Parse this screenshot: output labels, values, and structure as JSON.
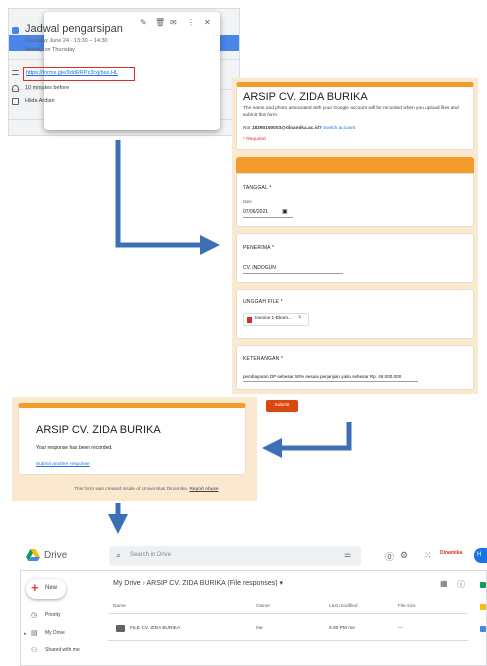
{
  "calendar": {
    "title": "Jadwal pengarsipan",
    "when": "Thursday June 24 · 13:30 – 14:30",
    "repeat": "Weekly on Thursday",
    "link": "https://forms.gle/9ddRRPz3rxj/bas.HL",
    "reminder": "10 minutes before",
    "owner": "Hilda Ardiari",
    "tools": [
      "✎",
      "🗑",
      "✉",
      "⋮",
      "✕"
    ]
  },
  "form": {
    "title": "ARSIP CV. ZIDA BURIKA",
    "description": "The name and photo associated with your Google account will be recorded when you upload files and submit this form",
    "account_prefix": "Not",
    "account": "18390150003@dinamika.ac.id?",
    "switch_account": "Switch account",
    "required_note": "* Required",
    "q_date_label": "TANGGAL *",
    "q_date_sub": "Date",
    "q_date_value": "07/06/2021",
    "q_receiver_label": "PENERIMA *",
    "q_receiver_value": "CV. INDOGUN",
    "q_file_label": "UNGGAH FILE *",
    "q_file_value": "Invoice 1-Ekom...",
    "q_notes_label": "KETERANGAN *",
    "q_notes_value": "pembayaran DP sebesar 50% sesuai perjanjian yaitu sebesar Rp. 46.000.000",
    "submit": "Submit"
  },
  "response": {
    "title": "ARSIP CV. ZIDA BURIKA",
    "message": "Your response has been recorded.",
    "another": "Submit another response",
    "footer": "This form was created inside of Universitas Dinamika.",
    "report": "Report Abuse"
  },
  "drive": {
    "app_name": "Drive",
    "search_placeholder": "Search in Drive",
    "new_label": "New",
    "nav": [
      "Priority",
      "My Drive",
      "Shared with me"
    ],
    "breadcrumb_root": "My Drive",
    "breadcrumb_folder": "ARSIP CV. ZIDA BURIKA (File responses)",
    "columns": [
      "Name",
      "Owner",
      "Last modified",
      "File size"
    ],
    "rows": [
      {
        "name": "FILE CV. ZIDA BURIKA",
        "owner": "me",
        "modified": "6:30 PM me",
        "size": "—"
      }
    ],
    "org_logo": "Dinamika",
    "avatar": "H"
  },
  "colors": {
    "form_accent": "#f39c2b",
    "form_background": "#fbe9cf",
    "arrow": "#3d6fb6",
    "highlight": "#d93025"
  }
}
